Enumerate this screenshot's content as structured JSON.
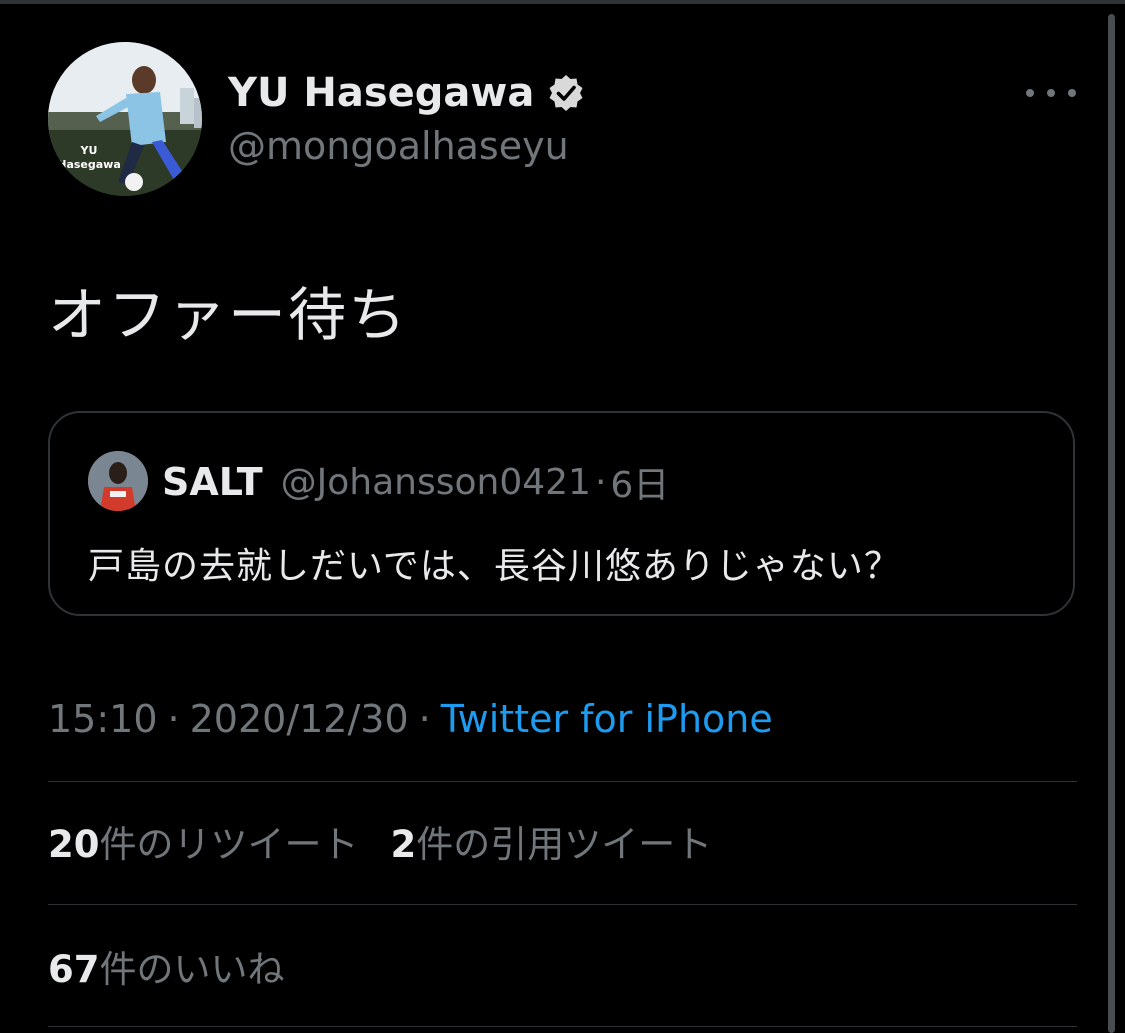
{
  "tweet": {
    "author": {
      "display_name": "YU Hasegawa",
      "handle": "@mongoalhaseyu",
      "avatar_caption": "YU Hasegawa",
      "verified": true
    },
    "text": "オファー待ち",
    "quoted": {
      "name": "SALT",
      "handle": "@Johansson0421",
      "separator": "·",
      "time_ago": "6日",
      "text": "戸島の去就しだいでは、長谷川悠ありじゃない？"
    },
    "meta": {
      "time": "15:10",
      "separator": "·",
      "date": "2020/12/30",
      "separator2": "·",
      "source": "Twitter for iPhone"
    },
    "stats": {
      "retweets_count": "20",
      "retweets_label": "件のリツイート",
      "quotes_count": "2",
      "quotes_label": "件の引用ツイート",
      "likes_count": "67",
      "likes_label": "件のいいね"
    }
  },
  "icons": {
    "more": "more-horizontal-icon",
    "verified": "verified-badge-icon"
  },
  "colors": {
    "background": "#000000",
    "text_primary": "#e7e9ea",
    "text_secondary": "#71767b",
    "link": "#1d9bf0",
    "border": "#2f3336"
  }
}
